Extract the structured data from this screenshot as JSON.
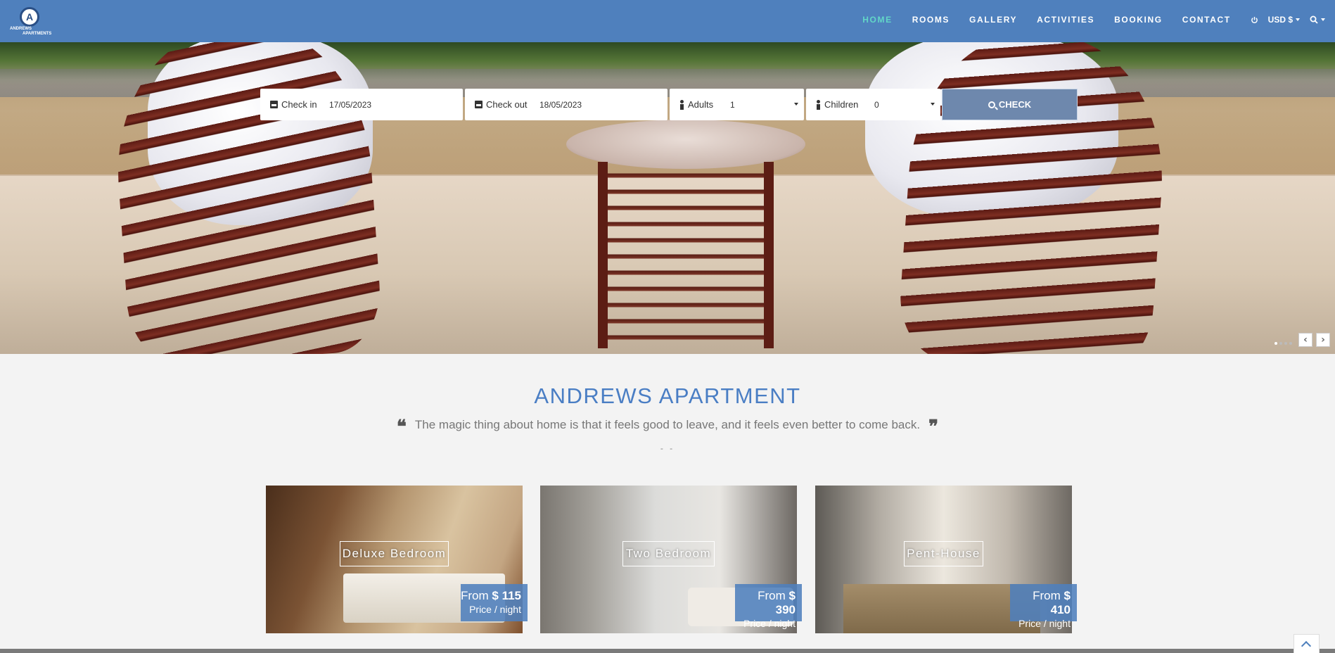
{
  "brand": {
    "logo_letter": "A",
    "logo_line1": "ANDREWS",
    "logo_line2": "APARTMENTS"
  },
  "nav": {
    "items": [
      "HOME",
      "ROOMS",
      "GALLERY",
      "ACTIVITIES",
      "BOOKING",
      "CONTACT"
    ],
    "active": "HOME",
    "currency": "USD $"
  },
  "booking": {
    "check_in_label": "Check in",
    "check_in_value": "17/05/2023",
    "check_out_label": "Check out",
    "check_out_value": "18/05/2023",
    "adults_label": "Adults",
    "adults_value": "1",
    "children_label": "Children",
    "children_value": "0",
    "check_button": "CHECK"
  },
  "slider": {
    "dot_count": 4,
    "active_dot": 1
  },
  "intro": {
    "title": "ANDREWS APARTMENT",
    "quote": "The magic thing about home is that it feels good to leave, and it feels even better to come back.",
    "divider": "- -"
  },
  "rooms": [
    {
      "name": "Deluxe Bedroom",
      "from_label": "From",
      "price": "$ 115",
      "per": "Price / night"
    },
    {
      "name": "Two Bedroom",
      "from_label": "From",
      "price": "$ 390",
      "per": "Price / night"
    },
    {
      "name": "Pent-House",
      "from_label": "From",
      "price": "$ 410",
      "per": "Price / night"
    }
  ],
  "colors": {
    "primary": "#4f80bd",
    "active_nav": "#62d6c7",
    "title": "#4a7ec4"
  }
}
